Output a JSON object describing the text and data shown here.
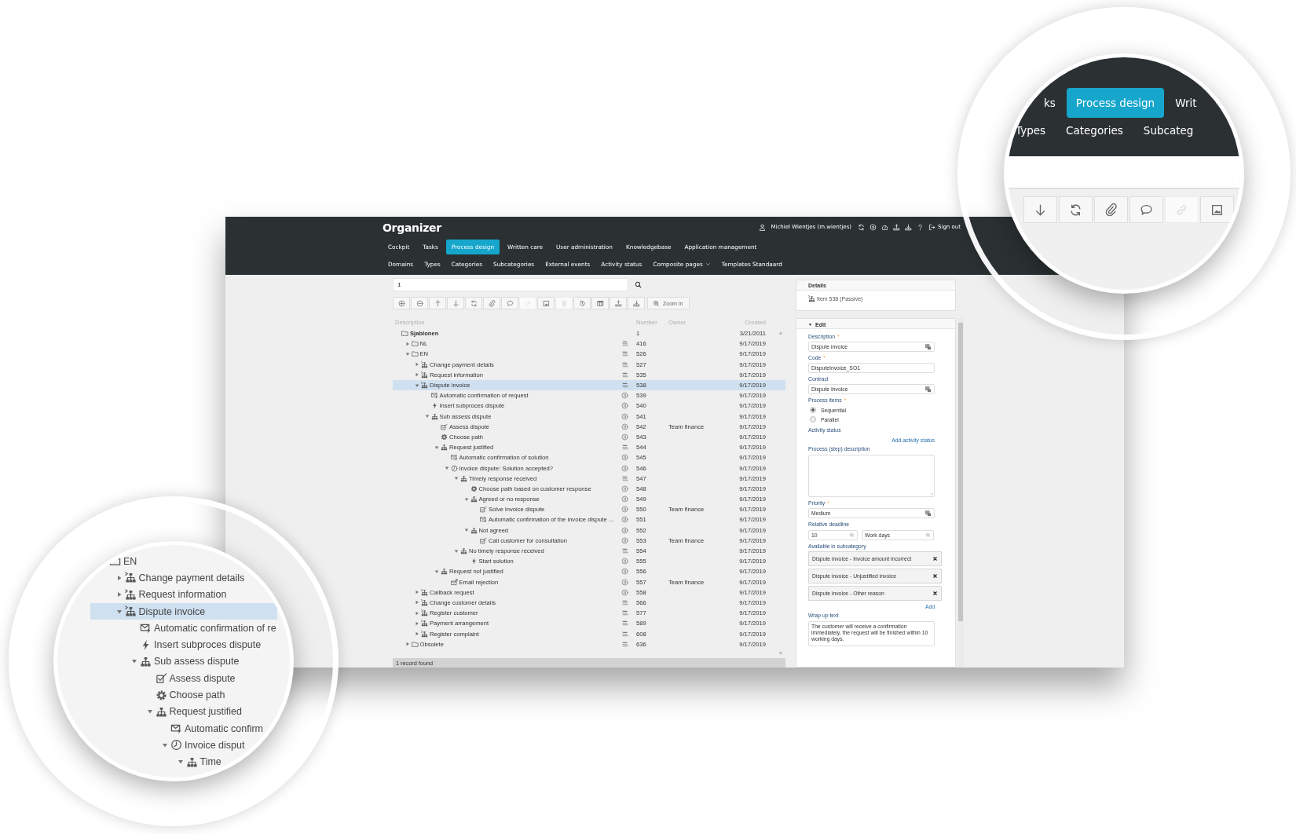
{
  "app": {
    "title": "Organizer",
    "user": "Michiel Wientjes (m.wientjes)",
    "sign_out": "Sign out"
  },
  "nav": [
    {
      "label": "Cockpit",
      "selected": false
    },
    {
      "label": "Tasks",
      "selected": false
    },
    {
      "label": "Process design",
      "selected": true
    },
    {
      "label": "Written care",
      "selected": false
    },
    {
      "label": "User administration",
      "selected": false
    },
    {
      "label": "Knowledgebase",
      "selected": false
    },
    {
      "label": "Application management",
      "selected": false
    }
  ],
  "subnav": [
    {
      "label": "Domains",
      "dropdown": false
    },
    {
      "label": "Types",
      "dropdown": false
    },
    {
      "label": "Categories",
      "dropdown": false
    },
    {
      "label": "Subcategories",
      "dropdown": false
    },
    {
      "label": "External events",
      "dropdown": false
    },
    {
      "label": "Activity status",
      "dropdown": false
    },
    {
      "label": "Composite pages",
      "dropdown": true
    },
    {
      "label": "Templates Standaard",
      "dropdown": false
    }
  ],
  "search": {
    "value": "1"
  },
  "toolbar": [
    {
      "disabled": false
    },
    {
      "disabled": false
    },
    {
      "disabled": false
    },
    {
      "disabled": false
    },
    {
      "disabled": false
    },
    {
      "disabled": false
    },
    {
      "disabled": false
    },
    {
      "disabled": true
    },
    {
      "disabled": false
    },
    {
      "disabled": true
    },
    {
      "disabled": false
    },
    {
      "disabled": false
    },
    {
      "disabled": false
    },
    {
      "disabled": false
    }
  ],
  "zoom_button": {
    "label": "Zoom in"
  },
  "table": {
    "columns": [
      "Description",
      "Number",
      "Owner",
      "Created"
    ],
    "tree": [
      {
        "label": "Sjablonen",
        "kind": "folder",
        "number": "1",
        "created": "3/21/2011",
        "selected": false,
        "children": [
          {
            "label": "NL",
            "kind": "folder",
            "status": {
              "kind": "stack"
            },
            "number": "416",
            "created": "9/17/2019",
            "expanded": false,
            "selected": false
          },
          {
            "label": "EN",
            "kind": "folder",
            "status": {
              "kind": "stack"
            },
            "number": "526",
            "created": "9/17/2019",
            "expanded": true,
            "selected": false,
            "children": [
              {
                "label": "Change payment details",
                "kind": "process",
                "status": {
                  "kind": "stack"
                },
                "number": "527",
                "created": "9/17/2019",
                "expanded": false,
                "selected": false
              },
              {
                "label": "Request information",
                "kind": "process",
                "status": {
                  "kind": "stack"
                },
                "number": "535",
                "created": "9/17/2019",
                "expanded": false,
                "selected": false
              },
              {
                "label": "Dispute invoice",
                "kind": "process",
                "status": {
                  "kind": "stack"
                },
                "number": "538",
                "created": "9/17/2019",
                "expanded": true,
                "selected": true,
                "children": [
                  {
                    "label": "Automatic confirmation of request",
                    "kind": "mail",
                    "status": {
                      "kind": "pause"
                    },
                    "number": "539",
                    "created": "9/17/2019",
                    "selected": false
                  },
                  {
                    "label": "Insert subproces dispute",
                    "kind": "bolt",
                    "status": {
                      "kind": "pause"
                    },
                    "number": "540",
                    "created": "9/17/2019",
                    "selected": false
                  },
                  {
                    "label": "Sub assess dispute",
                    "kind": "flow",
                    "status": {
                      "kind": "pause"
                    },
                    "number": "541",
                    "created": "9/17/2019",
                    "expanded": true,
                    "selected": false,
                    "children": [
                      {
                        "label": "Assess dispute",
                        "kind": "task",
                        "status": {
                          "kind": "pause"
                        },
                        "number": "542",
                        "owner": "Team finance",
                        "created": "9/17/2019",
                        "selected": false
                      },
                      {
                        "label": "Choose path",
                        "kind": "gear",
                        "status": {
                          "kind": "pause"
                        },
                        "number": "543",
                        "created": "9/17/2019",
                        "selected": false
                      },
                      {
                        "label": "Request justified",
                        "kind": "flow",
                        "status": {
                          "kind": "stack"
                        },
                        "number": "544",
                        "created": "9/17/2019",
                        "expanded": true,
                        "selected": false,
                        "children": [
                          {
                            "label": "Automatic confirmation of solution",
                            "kind": "mail",
                            "status": {
                              "kind": "pause"
                            },
                            "number": "545",
                            "created": "9/17/2019",
                            "selected": false
                          },
                          {
                            "label": "Invoice dispute: Solution accepted?",
                            "kind": "clock",
                            "status": {
                              "kind": "pause"
                            },
                            "number": "546",
                            "created": "9/17/2019",
                            "expanded": true,
                            "selected": false,
                            "children": [
                              {
                                "label": "Timely response received",
                                "kind": "flow",
                                "status": {
                                  "kind": "stack"
                                },
                                "number": "547",
                                "created": "9/17/2019",
                                "expanded": true,
                                "selected": false,
                                "children": [
                                  {
                                    "label": "Choose path based on customer response",
                                    "kind": "gear",
                                    "status": {
                                      "kind": "pause"
                                    },
                                    "number": "548",
                                    "created": "9/17/2019",
                                    "selected": false
                                  },
                                  {
                                    "label": "Agreed or no response",
                                    "kind": "flow",
                                    "status": {
                                      "kind": "pause"
                                    },
                                    "number": "549",
                                    "created": "9/17/2019",
                                    "expanded": true,
                                    "selected": false,
                                    "children": [
                                      {
                                        "label": "Solve invoice dispute",
                                        "kind": "task",
                                        "status": {
                                          "kind": "pause"
                                        },
                                        "number": "550",
                                        "owner": "Team finance",
                                        "created": "9/17/2019",
                                        "selected": false
                                      },
                                      {
                                        "label": "Automatic confirmation of the invoice dispute ...",
                                        "kind": "mail",
                                        "status": {
                                          "kind": "pause"
                                        },
                                        "number": "551",
                                        "created": "9/17/2019",
                                        "selected": false
                                      }
                                    ]
                                  },
                                  {
                                    "label": "Not agreed",
                                    "kind": "flow",
                                    "status": {
                                      "kind": "pause"
                                    },
                                    "number": "552",
                                    "created": "9/17/2019",
                                    "expanded": true,
                                    "selected": false,
                                    "children": [
                                      {
                                        "label": "Call customer for consultation",
                                        "kind": "task",
                                        "status": {
                                          "kind": "pause"
                                        },
                                        "number": "553",
                                        "owner": "Team finance",
                                        "created": "9/17/2019",
                                        "selected": false
                                      }
                                    ]
                                  }
                                ]
                              },
                              {
                                "label": "No timely response received",
                                "kind": "flow",
                                "status": {
                                  "kind": "stack"
                                },
                                "number": "554",
                                "created": "9/17/2019",
                                "expanded": true,
                                "selected": false,
                                "children": [
                                  {
                                    "label": "Start solution",
                                    "kind": "bolt",
                                    "status": {
                                      "kind": "pause"
                                    },
                                    "number": "555",
                                    "created": "9/17/2019",
                                    "selected": false
                                  }
                                ]
                              }
                            ]
                          }
                        ]
                      },
                      {
                        "label": "Request not justified",
                        "kind": "flow",
                        "status": {
                          "kind": "pause"
                        },
                        "number": "556",
                        "created": "9/17/2019",
                        "expanded": true,
                        "selected": false,
                        "children": [
                          {
                            "label": "Email rejection",
                            "kind": "email",
                            "status": {
                              "kind": "pause"
                            },
                            "number": "557",
                            "owner": "Team finance",
                            "created": "9/17/2019",
                            "selected": false
                          }
                        ]
                      }
                    ]
                  }
                ]
              },
              {
                "label": "Callback request",
                "kind": "process",
                "status": {
                  "kind": "pause"
                },
                "number": "558",
                "created": "9/17/2019",
                "expanded": false,
                "selected": false
              },
              {
                "label": "Change customer details",
                "kind": "process",
                "status": {
                  "kind": "stack"
                },
                "number": "566",
                "created": "9/17/2019",
                "expanded": false,
                "selected": false
              },
              {
                "label": "Register customer",
                "kind": "process",
                "status": {
                  "kind": "stack"
                },
                "number": "577",
                "created": "9/17/2019",
                "expanded": false,
                "selected": false
              },
              {
                "label": "Payment arrangement",
                "kind": "process",
                "status": {
                  "kind": "stack"
                },
                "number": "589",
                "created": "9/17/2019",
                "expanded": false,
                "selected": false
              },
              {
                "label": "Register complaint",
                "kind": "process",
                "status": {
                  "kind": "stack"
                },
                "number": "608",
                "created": "9/17/2019",
                "expanded": false,
                "selected": false
              }
            ]
          },
          {
            "label": "Obsolete",
            "kind": "folder",
            "status": {
              "kind": "stack"
            },
            "number": "636",
            "created": "9/17/2019",
            "expanded": false,
            "selected": false
          }
        ]
      }
    ]
  },
  "status_bar": "1 record found",
  "details": {
    "title": "Details",
    "kind": "process",
    "item": "Item 538 (Passive)"
  },
  "edit": {
    "title": "Edit",
    "expanded": true,
    "required_mark": "*",
    "fields": [
      {
        "kind": "lookup",
        "label": "Description",
        "required": true,
        "value": "Dispute invoice"
      },
      {
        "kind": "text",
        "label": "Code",
        "required": true,
        "value": "DisputeInvoice_SO1"
      },
      {
        "kind": "lookup",
        "label": "Contract",
        "required": false,
        "value": "Dispute Invoice"
      },
      {
        "kind": "radio",
        "label": "Process items",
        "required": true,
        "options": [
          {
            "label": "Sequential",
            "selected": true
          },
          {
            "label": "Parallel",
            "selected": false
          }
        ]
      },
      {
        "kind": "links",
        "label": "Activity status",
        "required": false,
        "link": "Add activity status"
      },
      {
        "kind": "textarea",
        "label": "Process (step) description",
        "required": false
      },
      {
        "kind": "lookup",
        "label": "Priority",
        "required": true,
        "value": "Medium"
      },
      {
        "kind": "pair",
        "label": "Relative deadline",
        "required": false,
        "values": [
          "10",
          "Work days"
        ]
      },
      {
        "kind": "chips",
        "label": "Available in subcategory",
        "required": false,
        "items": [
          "Dispute invoice - Invoice amount incorrect",
          "Dispute invoice - Unjustified invoice",
          "Dispute invoice - Other reason"
        ],
        "link": "Add"
      },
      {
        "kind": "textarea",
        "label": "Wrap up text",
        "required": false,
        "value": "The customer will receive a confirmation immediately, the request will be finished within 10 working days."
      }
    ]
  },
  "magnifier_top": {
    "nav": [
      {
        "label": "ks",
        "selected": false
      },
      {
        "label": "Process design",
        "selected": true
      },
      {
        "label": "Writ",
        "selected": false
      }
    ],
    "subnav": [
      "Types",
      "Categories",
      "Subcateg"
    ],
    "toolbar": [
      {
        "disabled": false
      },
      {
        "disabled": false
      },
      {
        "disabled": false
      },
      {
        "disabled": false
      },
      {
        "disabled": true
      },
      {
        "disabled": false
      }
    ]
  },
  "magnifier_left": {
    "tree": [
      {
        "label": "EN",
        "kind": "folder",
        "selected": false,
        "children": [
          {
            "label": "Change payment details",
            "kind": "process",
            "expanded": false,
            "selected": false
          },
          {
            "label": "Request information",
            "kind": "process",
            "expanded": false,
            "selected": false
          },
          {
            "label": "Dispute invoice",
            "kind": "process",
            "expanded": true,
            "selected": true,
            "children": [
              {
                "label": "Automatic confirmation of re",
                "kind": "mail",
                "selected": false
              },
              {
                "label": "Insert subproces dispute",
                "kind": "bolt",
                "selected": false
              },
              {
                "label": "Sub assess dispute",
                "kind": "flow",
                "expanded": true,
                "selected": false,
                "children": [
                  {
                    "label": "Assess dispute",
                    "kind": "task",
                    "selected": false
                  },
                  {
                    "label": "Choose path",
                    "kind": "gear",
                    "selected": false
                  },
                  {
                    "label": "Request justified",
                    "kind": "flow",
                    "expanded": true,
                    "selected": false,
                    "children": [
                      {
                        "label": "Automatic confirm",
                        "kind": "mail",
                        "selected": false
                      },
                      {
                        "label": "Invoice disput",
                        "kind": "clock",
                        "expanded": true,
                        "selected": false,
                        "children": [
                          {
                            "label": "Time",
                            "kind": "flow",
                            "expanded": true,
                            "selected": false
                          }
                        ]
                      }
                    ]
                  }
                ]
              }
            ]
          }
        ]
      }
    ]
  }
}
